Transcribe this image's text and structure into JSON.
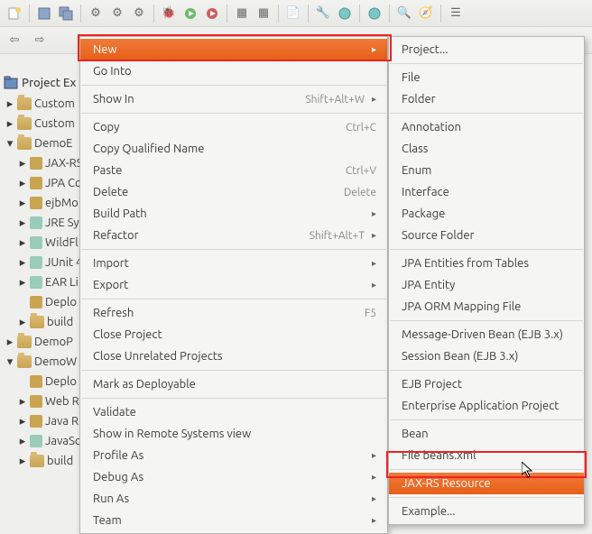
{
  "explorer_label": "Project Ex",
  "tree": [
    {
      "indent": 0,
      "exp": "▸",
      "icon": "fold",
      "label": "Custom"
    },
    {
      "indent": 0,
      "exp": "▸",
      "icon": "fold",
      "label": "Custom"
    },
    {
      "indent": 0,
      "exp": "▾",
      "icon": "fold",
      "label": "DemoE"
    },
    {
      "indent": 1,
      "exp": "▸",
      "icon": "pkg",
      "label": "JAX-RS"
    },
    {
      "indent": 1,
      "exp": "▸",
      "icon": "pkg",
      "label": "JPA Co"
    },
    {
      "indent": 1,
      "exp": "▸",
      "icon": "pkg",
      "label": "ejbMo"
    },
    {
      "indent": 1,
      "exp": "▸",
      "icon": "lib",
      "label": "JRE Sy"
    },
    {
      "indent": 1,
      "exp": "▸",
      "icon": "lib",
      "label": "WildFl"
    },
    {
      "indent": 1,
      "exp": "▸",
      "icon": "lib",
      "label": "JUnit 4"
    },
    {
      "indent": 1,
      "exp": "▸",
      "icon": "lib",
      "label": "EAR Li"
    },
    {
      "indent": 1,
      "exp": "",
      "icon": "pkg",
      "label": "Deplo"
    },
    {
      "indent": 1,
      "exp": "▸",
      "icon": "fold",
      "label": "build"
    },
    {
      "indent": 0,
      "exp": "▸",
      "icon": "fold",
      "label": "DemoP"
    },
    {
      "indent": 0,
      "exp": "▾",
      "icon": "fold",
      "label": "DemoW"
    },
    {
      "indent": 1,
      "exp": "",
      "icon": "pkg",
      "label": "Deplo"
    },
    {
      "indent": 1,
      "exp": "▸",
      "icon": "pkg",
      "label": "Web R"
    },
    {
      "indent": 1,
      "exp": "▸",
      "icon": "pkg",
      "label": "Java R"
    },
    {
      "indent": 1,
      "exp": "▸",
      "icon": "lib",
      "label": "JavaSc"
    },
    {
      "indent": 1,
      "exp": "▸",
      "icon": "fold",
      "label": "build"
    }
  ],
  "menu_main": [
    {
      "type": "item",
      "label": "New",
      "accel": "",
      "arrow": true,
      "sel": true
    },
    {
      "type": "item",
      "label": "Go Into",
      "accel": "",
      "arrow": false
    },
    {
      "type": "sep"
    },
    {
      "type": "item",
      "label": "Show In",
      "accel": "Shift+Alt+W",
      "arrow": true
    },
    {
      "type": "sep"
    },
    {
      "type": "item",
      "label": "Copy",
      "accel": "Ctrl+C",
      "arrow": false
    },
    {
      "type": "item",
      "label": "Copy Qualified Name",
      "accel": "",
      "arrow": false
    },
    {
      "type": "item",
      "label": "Paste",
      "accel": "Ctrl+V",
      "arrow": false
    },
    {
      "type": "item",
      "label": "Delete",
      "accel": "Delete",
      "arrow": false
    },
    {
      "type": "item",
      "label": "Build Path",
      "accel": "",
      "arrow": true
    },
    {
      "type": "item",
      "label": "Refactor",
      "accel": "Shift+Alt+T",
      "arrow": true
    },
    {
      "type": "sep"
    },
    {
      "type": "item",
      "label": "Import",
      "accel": "",
      "arrow": true
    },
    {
      "type": "item",
      "label": "Export",
      "accel": "",
      "arrow": true
    },
    {
      "type": "sep"
    },
    {
      "type": "item",
      "label": "Refresh",
      "accel": "F5",
      "arrow": false
    },
    {
      "type": "item",
      "label": "Close Project",
      "accel": "",
      "arrow": false
    },
    {
      "type": "item",
      "label": "Close Unrelated Projects",
      "accel": "",
      "arrow": false
    },
    {
      "type": "sep"
    },
    {
      "type": "item",
      "label": "Mark as Deployable",
      "accel": "",
      "arrow": false
    },
    {
      "type": "sep"
    },
    {
      "type": "item",
      "label": "Validate",
      "accel": "",
      "arrow": false
    },
    {
      "type": "item",
      "label": "Show in Remote Systems view",
      "accel": "",
      "arrow": false
    },
    {
      "type": "item",
      "label": "Profile As",
      "accel": "",
      "arrow": true
    },
    {
      "type": "item",
      "label": "Debug As",
      "accel": "",
      "arrow": true
    },
    {
      "type": "item",
      "label": "Run As",
      "accel": "",
      "arrow": true
    },
    {
      "type": "item",
      "label": "Team",
      "accel": "",
      "arrow": true
    }
  ],
  "menu_sub": [
    {
      "type": "item",
      "label": "Project..."
    },
    {
      "type": "sep"
    },
    {
      "type": "item",
      "label": "File"
    },
    {
      "type": "item",
      "label": "Folder"
    },
    {
      "type": "sep"
    },
    {
      "type": "item",
      "label": "Annotation"
    },
    {
      "type": "item",
      "label": "Class"
    },
    {
      "type": "item",
      "label": "Enum"
    },
    {
      "type": "item",
      "label": "Interface"
    },
    {
      "type": "item",
      "label": "Package"
    },
    {
      "type": "item",
      "label": "Source Folder"
    },
    {
      "type": "sep"
    },
    {
      "type": "item",
      "label": "JPA Entities from Tables"
    },
    {
      "type": "item",
      "label": "JPA Entity"
    },
    {
      "type": "item",
      "label": "JPA ORM Mapping File"
    },
    {
      "type": "sep"
    },
    {
      "type": "item",
      "label": "Message-Driven Bean (EJB 3.x)"
    },
    {
      "type": "item",
      "label": "Session Bean (EJB 3.x)"
    },
    {
      "type": "sep"
    },
    {
      "type": "item",
      "label": "EJB Project"
    },
    {
      "type": "item",
      "label": "Enterprise Application Project"
    },
    {
      "type": "sep"
    },
    {
      "type": "item",
      "label": "Bean"
    },
    {
      "type": "item",
      "label": "File beans.xml"
    },
    {
      "type": "sep"
    },
    {
      "type": "item",
      "label": "JAX-RS Resource",
      "sel": true
    },
    {
      "type": "sep"
    },
    {
      "type": "item",
      "label": "Example..."
    }
  ]
}
